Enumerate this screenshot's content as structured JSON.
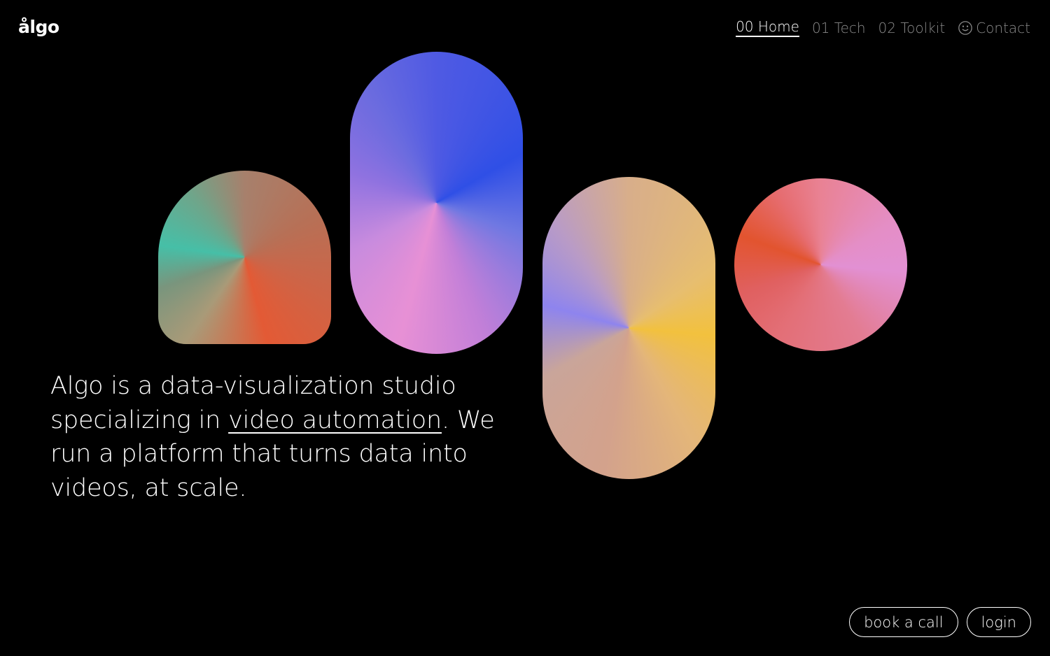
{
  "brand": {
    "logo_text": "ålgo"
  },
  "nav": {
    "items": [
      {
        "label": "00 Home",
        "active": true
      },
      {
        "label": "01 Tech",
        "active": false
      },
      {
        "label": "02 Toolkit",
        "active": false
      },
      {
        "label": "Contact",
        "icon": "smile-icon",
        "active": false
      }
    ]
  },
  "hero": {
    "line_prefix": "Algo is a data-visualization studio specializing in ",
    "link_text": "video automation",
    "line_suffix": ". We run a platform that turns data into videos, at scale."
  },
  "actions": {
    "book_label": "book a call",
    "login_label": "login"
  },
  "colors": {
    "background": "#000000",
    "text": "#ffffff",
    "nav_inactive": "#8a8a8a",
    "shape_teal": "#46bfa7",
    "shape_orange": "#e35a35",
    "shape_blue": "#2f4fe6",
    "shape_pink": "#e790d5",
    "shape_yellow": "#f2c13e",
    "shape_violet": "#8e84ee",
    "shape_red": "#e2542f"
  }
}
